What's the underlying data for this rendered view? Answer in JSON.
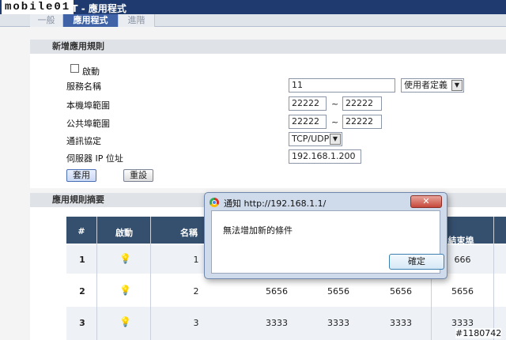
{
  "watermark": "mobile01",
  "header": {
    "title": "NAT - 應用程式"
  },
  "tabs": [
    {
      "label": "一般"
    },
    {
      "label": "應用程式"
    },
    {
      "label": "進階"
    }
  ],
  "form": {
    "section_title": "新增應用規則",
    "enable_label": "啟動",
    "service_name_label": "服務名稱",
    "service_name_value": "11",
    "service_type_selected": "使用者定義",
    "local_port_label": "本機埠範圍",
    "local_port_start": "22222",
    "local_port_end": "22222",
    "public_port_label": "公共埠範圍",
    "public_port_start": "22222",
    "public_port_end": "22222",
    "range_separator": "~",
    "protocol_label": "通訊協定",
    "protocol_selected": "TCP/UDP",
    "server_ip_label": "伺服器 IP 位址",
    "server_ip_value": "192.168.1.200",
    "apply_label": "套用",
    "reset_label": "重設"
  },
  "summary": {
    "section_title": "應用規則摘要",
    "headers": [
      "#",
      "啟動",
      "名稱",
      "結束埠"
    ],
    "rows": [
      {
        "num": "1",
        "name": "1",
        "c1": "",
        "c2": "",
        "c3": "",
        "end": "666"
      },
      {
        "num": "2",
        "name": "2",
        "c1": "5656",
        "c2": "5656",
        "c3": "5656",
        "end": "5656"
      },
      {
        "num": "3",
        "name": "3",
        "c1": "3333",
        "c2": "3333",
        "c3": "3333",
        "end": "3333"
      }
    ]
  },
  "dialog": {
    "title": "通知 http://192.168.1.1/",
    "message": "無法增加新的條件",
    "ok_label": "確定",
    "close_label": "✕"
  },
  "corner_label": "#1180742",
  "icons": {
    "select_arrow": "chevron-down-icon",
    "bulb": "light-bulb-icon",
    "browser": "chrome-icon"
  }
}
